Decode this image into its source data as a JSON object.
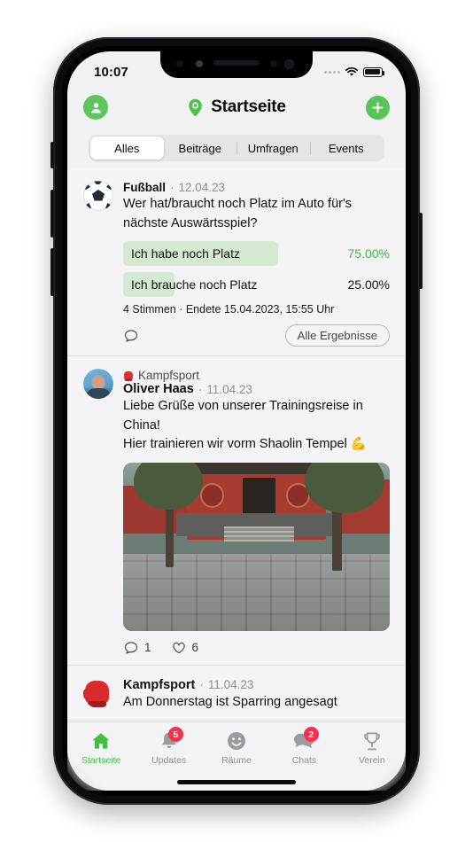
{
  "status_bar": {
    "time": "10:07",
    "wifi_icon": "wifi-icon",
    "battery_icon": "battery-full-icon"
  },
  "header": {
    "profile_icon": "person-circle-icon",
    "location_icon": "location-pin-icon",
    "title": "Startseite",
    "add_icon": "plus-circle-icon"
  },
  "segmented_control": {
    "selected": "Alles",
    "items": [
      {
        "label": "Alles",
        "active": true
      },
      {
        "label": "Beiträge",
        "active": false
      },
      {
        "label": "Umfragen",
        "active": false
      },
      {
        "label": "Events",
        "active": false
      }
    ]
  },
  "feed": {
    "poll_post": {
      "avatar_icon": "soccer-ball-icon",
      "group": "Fußball",
      "separator": "·",
      "date": "12.04.23",
      "question_line1": "Wer hat/braucht noch Platz im Auto für's",
      "question_line2": "nächste Auswärtsspiel?",
      "options": [
        {
          "label": "Ich habe noch Platz",
          "percent": "75.00%",
          "fill": 75,
          "leading": true
        },
        {
          "label": "Ich brauche noch Platz",
          "percent": "25.00%",
          "fill": 25,
          "leading": false
        }
      ],
      "info": "4 Stimmen · Endete 15.04.2023, 15:55 Uhr",
      "comment_icon": "comment-bubble-icon",
      "results_button": "Alle Ergebnisse"
    },
    "photo_post": {
      "avatar_icon": "user-photo-avatar",
      "group_icon": "boxing-glove-icon",
      "group": "Kampfsport",
      "author": "Oliver Haas",
      "separator": "·",
      "date": "11.04.23",
      "body_line1": "Liebe Grüße von unserer Trainingsreise in",
      "body_line2": "China!",
      "body_line3": "Hier trainieren wir vorm Shaolin Tempel 💪",
      "photo_alt": "shaolin-training-photo",
      "comment_icon": "comment-bubble-icon",
      "comment_count": "1",
      "like_icon": "heart-icon",
      "like_count": "6"
    },
    "third_post": {
      "avatar_icon": "boxing-glove-icon",
      "group": "Kampfsport",
      "separator": "·",
      "date": "11.04.23",
      "body_line1": "Am Donnerstag ist Sparring angesagt"
    }
  },
  "tab_bar": {
    "items": [
      {
        "label": "Startseite",
        "icon": "home-icon",
        "active": true,
        "badge": null
      },
      {
        "label": "Updates",
        "icon": "bell-icon",
        "active": false,
        "badge": "5"
      },
      {
        "label": "Räume",
        "icon": "smiley-icon",
        "active": false,
        "badge": null
      },
      {
        "label": "Chats",
        "icon": "chat-bubbles-icon",
        "active": false,
        "badge": "2"
      },
      {
        "label": "Verein",
        "icon": "trophy-icon",
        "active": false,
        "badge": null
      }
    ]
  },
  "colors": {
    "accent_green": "#4CC24C",
    "poll_fill": "#D4EAD0",
    "poll_lead_text": "#41B63F",
    "badge_red": "#F4314E",
    "background": "#F4F4F6"
  }
}
